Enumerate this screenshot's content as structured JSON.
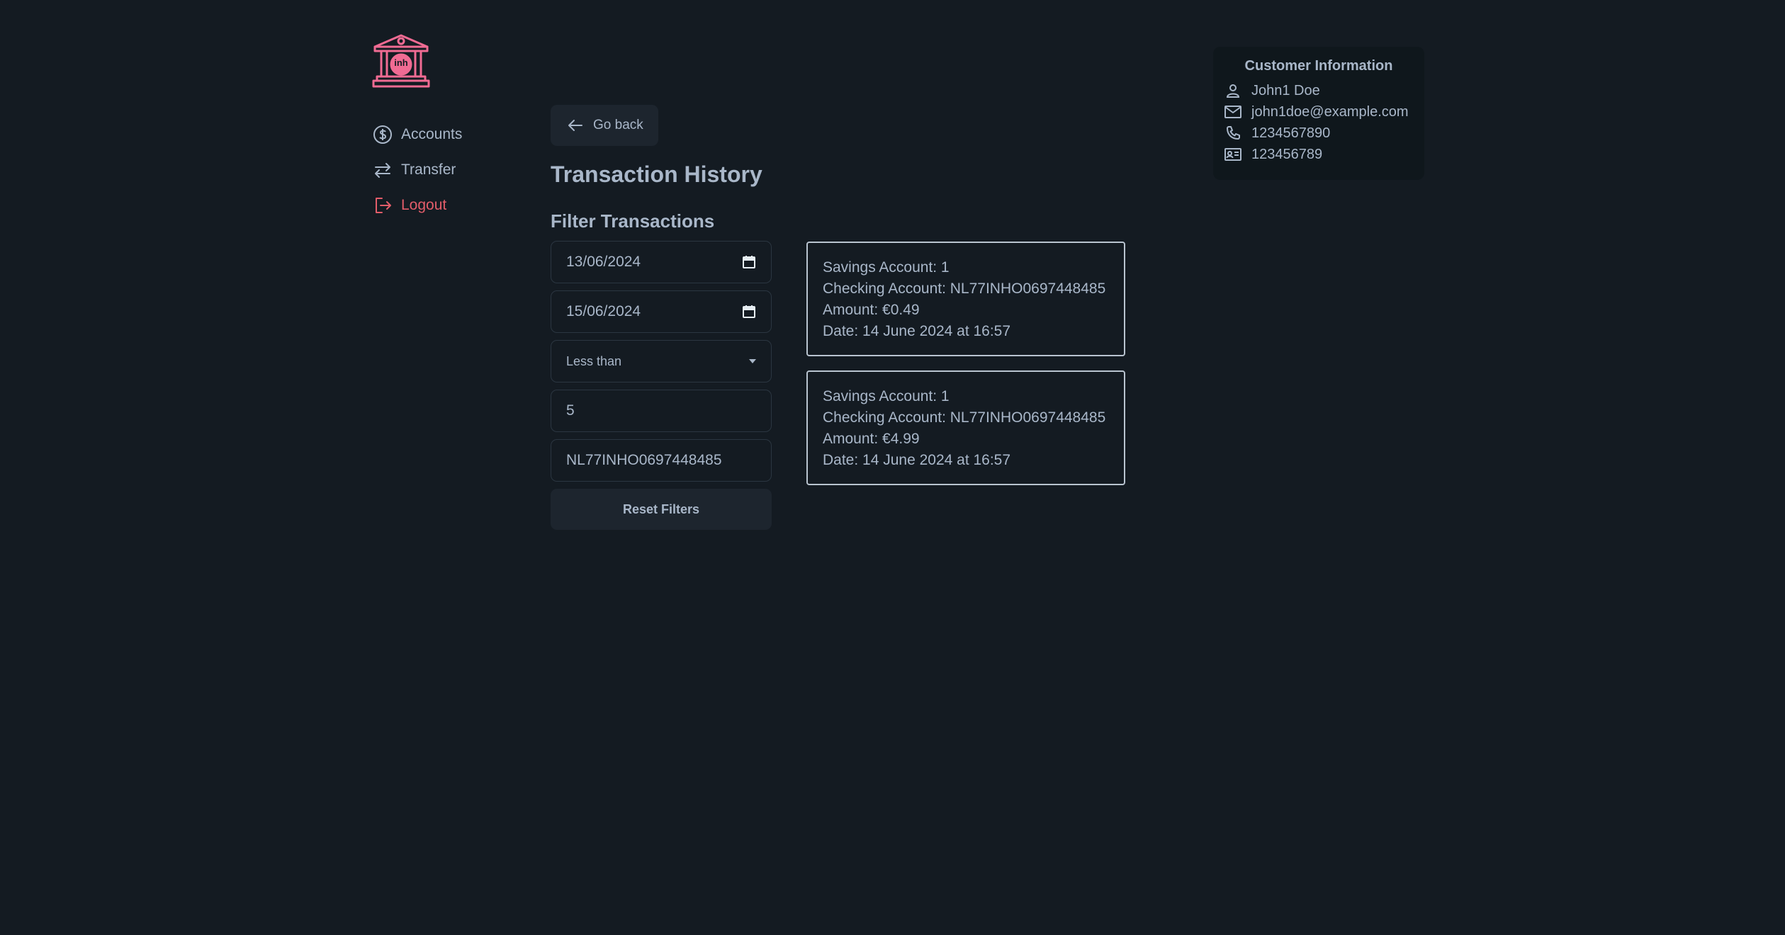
{
  "colors": {
    "background": "#141b22",
    "text": "#a9b7c9",
    "logout": "#e35d6a",
    "logo": "#f06b93"
  },
  "logo": {
    "text": "inh"
  },
  "nav": {
    "items": [
      {
        "label": "Accounts",
        "icon": "dollar-circle-icon"
      },
      {
        "label": "Transfer",
        "icon": "arrows-swap-icon"
      },
      {
        "label": "Logout",
        "icon": "logout-icon"
      }
    ]
  },
  "main": {
    "back_label": "Go back",
    "title": "Transaction History",
    "filter_title": "Filter Transactions"
  },
  "filters": {
    "date_from": "13/06/2024",
    "date_to": "15/06/2024",
    "comparison": "Less than",
    "amount": "5",
    "iban": "NL77INHO0697448485",
    "reset_label": "Reset Filters"
  },
  "transactions": [
    {
      "savings": "Savings Account: 1",
      "checking": "Checking Account: NL77INHO0697448485",
      "amount": "Amount: €0.49",
      "date": "Date: 14 June 2024 at 16:57"
    },
    {
      "savings": "Savings Account: 1",
      "checking": "Checking Account: NL77INHO0697448485",
      "amount": "Amount: €4.99",
      "date": "Date: 14 June 2024 at 16:57"
    }
  ],
  "customer": {
    "title": "Customer Information",
    "name": "John1 Doe",
    "email": "john1doe@example.com",
    "phone": "1234567890",
    "id": "123456789"
  }
}
